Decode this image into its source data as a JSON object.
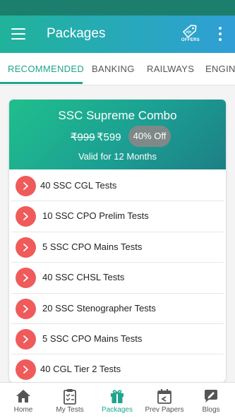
{
  "appbar": {
    "title": "Packages",
    "offers_label": "OFFERS"
  },
  "tabs": [
    {
      "label": "RECOMMENDED",
      "active": true
    },
    {
      "label": "BANKING",
      "active": false
    },
    {
      "label": "RAILWAYS",
      "active": false
    },
    {
      "label": "ENGINEERING",
      "active": false
    }
  ],
  "package": {
    "title": "SSC Supreme Combo",
    "old_price": "₹999",
    "new_price": "₹599",
    "discount": "40% Off",
    "validity": "Valid for 12 Months",
    "items": [
      {
        "label": "40 SSC CGL Tests"
      },
      {
        "label": "10 SSC CPO Prelim Tests"
      },
      {
        "label": "5 SSC CPO Mains Tests"
      },
      {
        "label": "40 SSC CHSL Tests"
      },
      {
        "label": "20 SSC Stenographer Tests"
      },
      {
        "label": "5 SSC CPO Mains Tests"
      },
      {
        "label": "40 CGL Tier 2 Tests"
      }
    ]
  },
  "bottom_nav": [
    {
      "label": "Home",
      "icon": "home-icon",
      "active": false
    },
    {
      "label": "My Tests",
      "icon": "clipboard-icon",
      "active": false
    },
    {
      "label": "Packages",
      "icon": "gift-icon",
      "active": true
    },
    {
      "label": "Prev Papers",
      "icon": "calendar-icon",
      "active": false
    },
    {
      "label": "Blogs",
      "icon": "blog-icon",
      "active": false
    }
  ],
  "colors": {
    "accent": "#1fa58c",
    "arrow_badge": "#ef5b5b",
    "status_bar": "#1c7f6e"
  }
}
